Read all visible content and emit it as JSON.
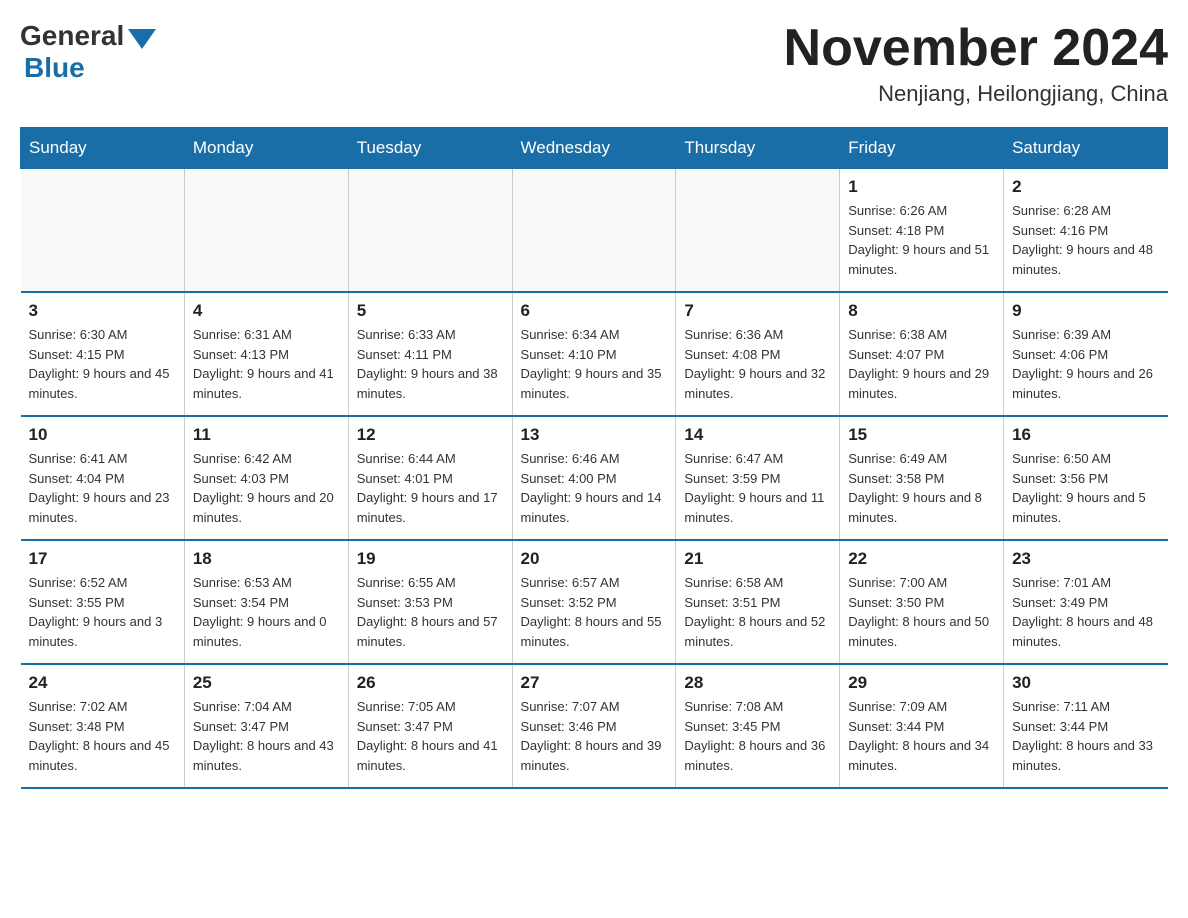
{
  "header": {
    "logo": {
      "general": "General",
      "blue": "Blue"
    },
    "title": "November 2024",
    "location": "Nenjiang, Heilongjiang, China"
  },
  "weekdays": [
    "Sunday",
    "Monday",
    "Tuesday",
    "Wednesday",
    "Thursday",
    "Friday",
    "Saturday"
  ],
  "weeks": [
    [
      {
        "day": "",
        "info": ""
      },
      {
        "day": "",
        "info": ""
      },
      {
        "day": "",
        "info": ""
      },
      {
        "day": "",
        "info": ""
      },
      {
        "day": "",
        "info": ""
      },
      {
        "day": "1",
        "info": "Sunrise: 6:26 AM\nSunset: 4:18 PM\nDaylight: 9 hours and 51 minutes."
      },
      {
        "day": "2",
        "info": "Sunrise: 6:28 AM\nSunset: 4:16 PM\nDaylight: 9 hours and 48 minutes."
      }
    ],
    [
      {
        "day": "3",
        "info": "Sunrise: 6:30 AM\nSunset: 4:15 PM\nDaylight: 9 hours and 45 minutes."
      },
      {
        "day": "4",
        "info": "Sunrise: 6:31 AM\nSunset: 4:13 PM\nDaylight: 9 hours and 41 minutes."
      },
      {
        "day": "5",
        "info": "Sunrise: 6:33 AM\nSunset: 4:11 PM\nDaylight: 9 hours and 38 minutes."
      },
      {
        "day": "6",
        "info": "Sunrise: 6:34 AM\nSunset: 4:10 PM\nDaylight: 9 hours and 35 minutes."
      },
      {
        "day": "7",
        "info": "Sunrise: 6:36 AM\nSunset: 4:08 PM\nDaylight: 9 hours and 32 minutes."
      },
      {
        "day": "8",
        "info": "Sunrise: 6:38 AM\nSunset: 4:07 PM\nDaylight: 9 hours and 29 minutes."
      },
      {
        "day": "9",
        "info": "Sunrise: 6:39 AM\nSunset: 4:06 PM\nDaylight: 9 hours and 26 minutes."
      }
    ],
    [
      {
        "day": "10",
        "info": "Sunrise: 6:41 AM\nSunset: 4:04 PM\nDaylight: 9 hours and 23 minutes."
      },
      {
        "day": "11",
        "info": "Sunrise: 6:42 AM\nSunset: 4:03 PM\nDaylight: 9 hours and 20 minutes."
      },
      {
        "day": "12",
        "info": "Sunrise: 6:44 AM\nSunset: 4:01 PM\nDaylight: 9 hours and 17 minutes."
      },
      {
        "day": "13",
        "info": "Sunrise: 6:46 AM\nSunset: 4:00 PM\nDaylight: 9 hours and 14 minutes."
      },
      {
        "day": "14",
        "info": "Sunrise: 6:47 AM\nSunset: 3:59 PM\nDaylight: 9 hours and 11 minutes."
      },
      {
        "day": "15",
        "info": "Sunrise: 6:49 AM\nSunset: 3:58 PM\nDaylight: 9 hours and 8 minutes."
      },
      {
        "day": "16",
        "info": "Sunrise: 6:50 AM\nSunset: 3:56 PM\nDaylight: 9 hours and 5 minutes."
      }
    ],
    [
      {
        "day": "17",
        "info": "Sunrise: 6:52 AM\nSunset: 3:55 PM\nDaylight: 9 hours and 3 minutes."
      },
      {
        "day": "18",
        "info": "Sunrise: 6:53 AM\nSunset: 3:54 PM\nDaylight: 9 hours and 0 minutes."
      },
      {
        "day": "19",
        "info": "Sunrise: 6:55 AM\nSunset: 3:53 PM\nDaylight: 8 hours and 57 minutes."
      },
      {
        "day": "20",
        "info": "Sunrise: 6:57 AM\nSunset: 3:52 PM\nDaylight: 8 hours and 55 minutes."
      },
      {
        "day": "21",
        "info": "Sunrise: 6:58 AM\nSunset: 3:51 PM\nDaylight: 8 hours and 52 minutes."
      },
      {
        "day": "22",
        "info": "Sunrise: 7:00 AM\nSunset: 3:50 PM\nDaylight: 8 hours and 50 minutes."
      },
      {
        "day": "23",
        "info": "Sunrise: 7:01 AM\nSunset: 3:49 PM\nDaylight: 8 hours and 48 minutes."
      }
    ],
    [
      {
        "day": "24",
        "info": "Sunrise: 7:02 AM\nSunset: 3:48 PM\nDaylight: 8 hours and 45 minutes."
      },
      {
        "day": "25",
        "info": "Sunrise: 7:04 AM\nSunset: 3:47 PM\nDaylight: 8 hours and 43 minutes."
      },
      {
        "day": "26",
        "info": "Sunrise: 7:05 AM\nSunset: 3:47 PM\nDaylight: 8 hours and 41 minutes."
      },
      {
        "day": "27",
        "info": "Sunrise: 7:07 AM\nSunset: 3:46 PM\nDaylight: 8 hours and 39 minutes."
      },
      {
        "day": "28",
        "info": "Sunrise: 7:08 AM\nSunset: 3:45 PM\nDaylight: 8 hours and 36 minutes."
      },
      {
        "day": "29",
        "info": "Sunrise: 7:09 AM\nSunset: 3:44 PM\nDaylight: 8 hours and 34 minutes."
      },
      {
        "day": "30",
        "info": "Sunrise: 7:11 AM\nSunset: 3:44 PM\nDaylight: 8 hours and 33 minutes."
      }
    ]
  ]
}
